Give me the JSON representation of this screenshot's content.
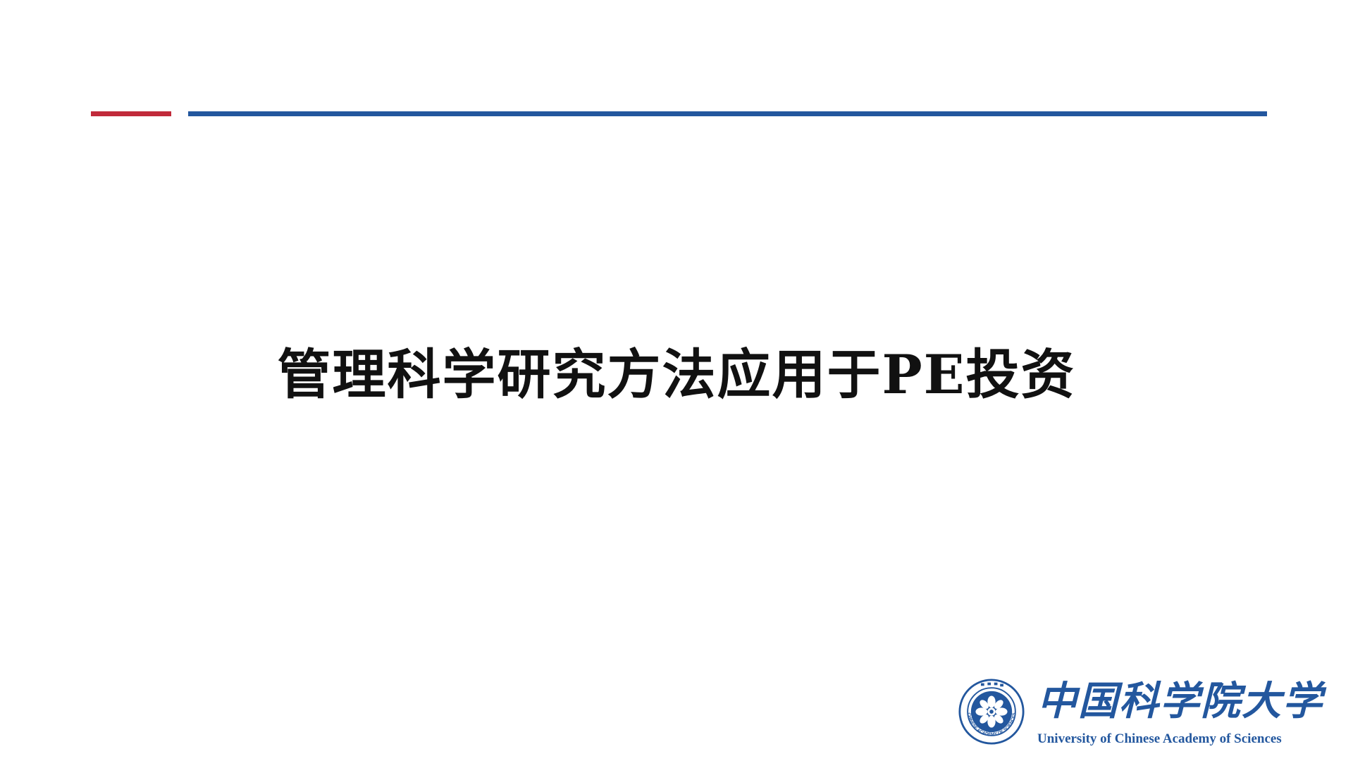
{
  "slide": {
    "title": "管理科学研究方法应用于PE投资"
  },
  "logo": {
    "name_cn": "中国科学院大学",
    "name_en": "University of  Chinese Academy of Sciences",
    "seal_label": "CHINESE ACADEMY OF SCIENCES"
  },
  "colors": {
    "accent_red": "#c12a3a",
    "accent_blue": "#23579e",
    "title_text": "#111111"
  }
}
